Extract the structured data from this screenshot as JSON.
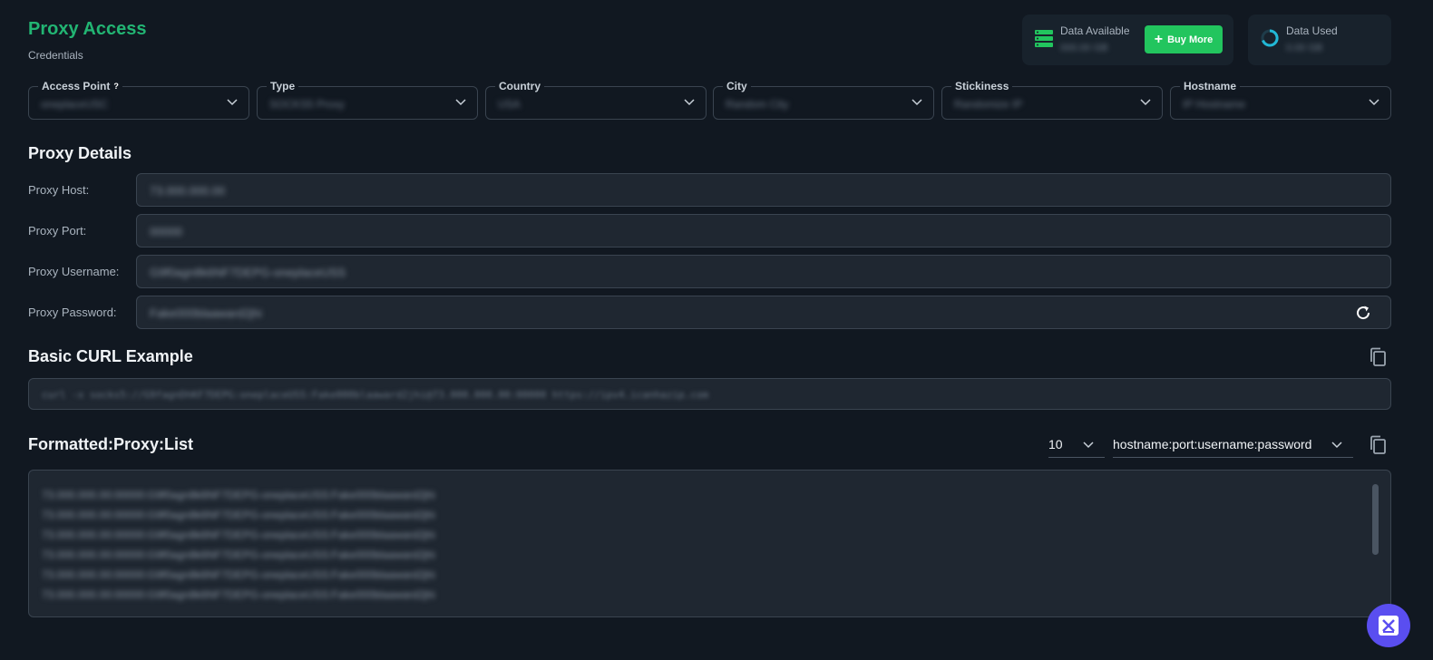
{
  "header": {
    "title": "Proxy Access",
    "subtitle": "Credentials"
  },
  "stats": {
    "available": {
      "label": "Data Available",
      "value": "000.00 GB",
      "icon": "server-stack-icon"
    },
    "buy_label": "Buy More",
    "used": {
      "label": "Data Used",
      "value": "0.00 GB",
      "icon": "donut-progress-icon"
    }
  },
  "filters": [
    {
      "label": "Access Point",
      "value": "oneplaceUSC",
      "help": "?"
    },
    {
      "label": "Type",
      "value": "SOCKS5 Proxy"
    },
    {
      "label": "Country",
      "value": "USA"
    },
    {
      "label": "City",
      "value": "Random City"
    },
    {
      "label": "Stickiness",
      "value": "Randomize IP"
    },
    {
      "label": "Hostname",
      "value": "IP Hostname"
    }
  ],
  "proxy_details": {
    "title": "Proxy Details",
    "host": {
      "label": "Proxy Host:",
      "value": "73.000.000.00"
    },
    "port": {
      "label": "Proxy Port:",
      "value": "00000"
    },
    "username": {
      "label": "Proxy Username:",
      "value": "G9f0agn8k6NF7DEPG-oneplaceUSS"
    },
    "password": {
      "label": "Proxy Password:",
      "value": "Fake000blaaward2jhi"
    }
  },
  "curl": {
    "title": "Basic CURL Example",
    "command": "curl -x socks5://G9fagnDhKF7DEPG:oneplaceUSS:Fake000blaaward2jhi@73.000.000.00:00000 https://ipv4.icanhazip.com"
  },
  "list": {
    "title": "Formatted:Proxy:List",
    "count": "10",
    "format": "hostname:port:username:password",
    "lines": [
      "73.000.000.00:00000:G9f0agn8k6NF7DEPG-oneplaceUSS:Fake000blaaward2jhi",
      "73.000.000.00:00000:G9f0agn8k6NF7DEPG-oneplaceUSS:Fake000blaaward2jhi",
      "73.000.000.00:00000:G9f0agn8k6NF7DEPG-oneplaceUSS:Fake000blaaward2jhi",
      "73.000.000.00:00000:G9f0agn8k6NF7DEPG-oneplaceUSS:Fake000blaaward2jhi",
      "73.000.000.00:00000:G9f0agn8k6NF7DEPG-oneplaceUSS:Fake000blaaward2jhi",
      "73.000.000.00:00000:G9f0agn8k6NF7DEPG-oneplaceUSS:Fake000blaaward2jhi"
    ]
  },
  "colors": {
    "accent": "#22b573",
    "buy_button": "#22c55e",
    "fab": "#5a4ef0",
    "background": "#111821"
  }
}
